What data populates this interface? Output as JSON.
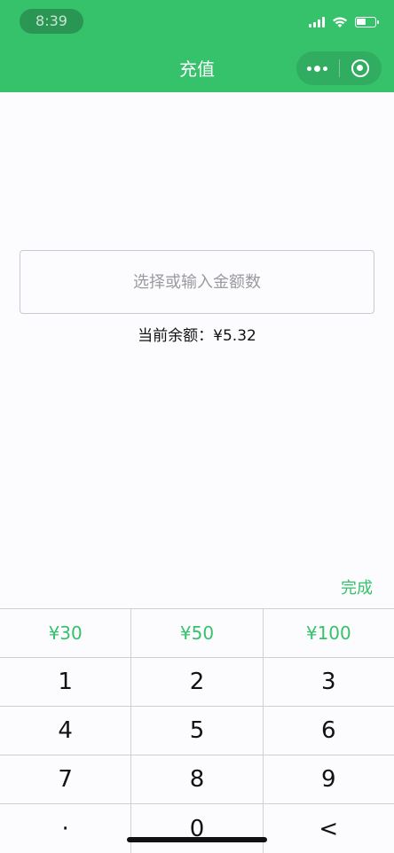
{
  "status_bar": {
    "time": "8:39"
  },
  "nav": {
    "title": "充值"
  },
  "form": {
    "amount_placeholder": "选择或输入金额数",
    "amount_value": "",
    "balance_text": "当前余额：¥5.32"
  },
  "keyboard": {
    "done_label": "完成",
    "quick_amounts": [
      "¥30",
      "¥50",
      "¥100"
    ],
    "keys": [
      [
        "1",
        "2",
        "3"
      ],
      [
        "4",
        "5",
        "6"
      ],
      [
        "7",
        "8",
        "9"
      ],
      [
        "·",
        "0",
        "<"
      ]
    ]
  },
  "colors": {
    "accent": "#36c16b",
    "text": "#111111",
    "placeholder": "#9a9aa0"
  }
}
